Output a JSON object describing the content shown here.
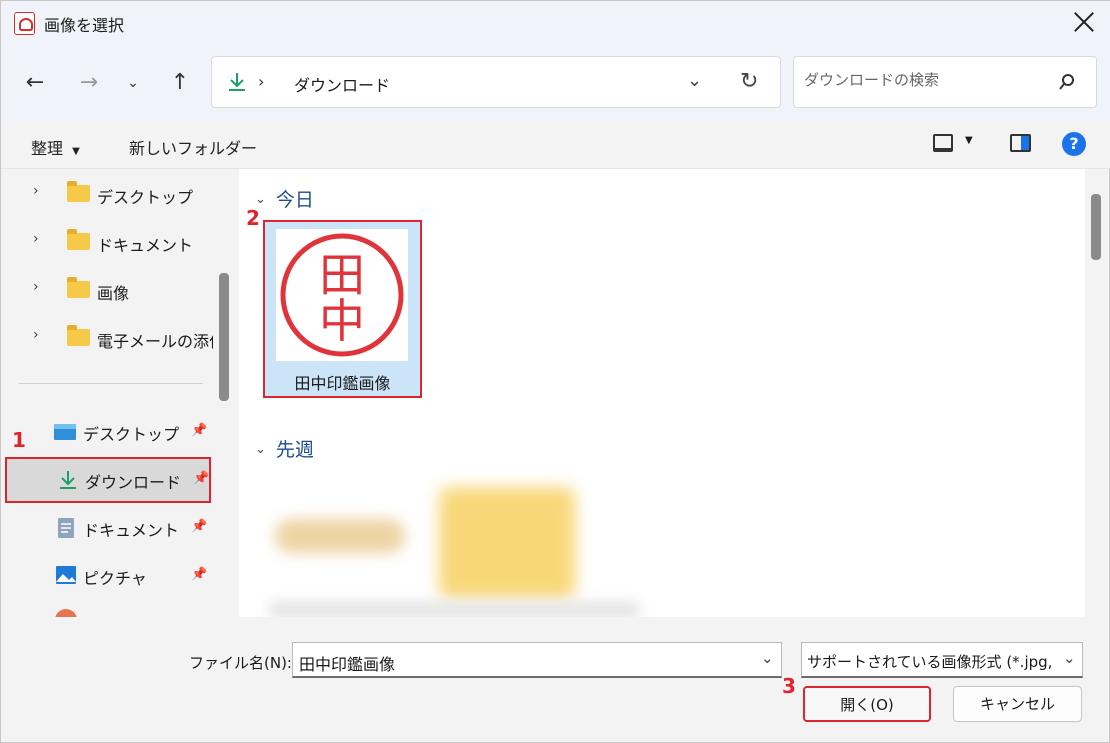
{
  "window": {
    "title": "画像を選択"
  },
  "address": {
    "current": "ダウンロード"
  },
  "search": {
    "placeholder": "ダウンロードの検索"
  },
  "toolbar": {
    "organize": "整理",
    "new_folder": "新しいフォルダー",
    "help": "?"
  },
  "sidebar": {
    "tree": [
      {
        "label": "デスクトップ",
        "icon": "folder-icon"
      },
      {
        "label": "ドキュメント",
        "icon": "folder-icon"
      },
      {
        "label": "画像",
        "icon": "folder-icon"
      },
      {
        "label": "電子メールの添付",
        "icon": "folder-icon"
      }
    ],
    "quick": [
      {
        "label": "デスクトップ",
        "icon": "desktop-icon",
        "selected": false
      },
      {
        "label": "ダウンロード",
        "icon": "download-icon",
        "selected": true
      },
      {
        "label": "ドキュメント",
        "icon": "document-icon",
        "selected": false
      },
      {
        "label": "ピクチャ",
        "icon": "picture-icon",
        "selected": false
      }
    ]
  },
  "content": {
    "groups": [
      {
        "label": "今日"
      },
      {
        "label": "先週"
      }
    ],
    "file": {
      "name": "田中印鑑画像",
      "seal_text": [
        "田",
        "中"
      ]
    }
  },
  "steps": [
    "1",
    "2",
    "3"
  ],
  "bottom": {
    "filename_label": "ファイル名(N):",
    "filename_value": "田中印鑑画像",
    "filetype": "サポートされている画像形式 (*.jpg, ",
    "open_button": "開く(O)",
    "cancel_button": "キャンセル"
  },
  "colors": {
    "highlight": "#e0242f",
    "accent": "#1a73e8",
    "seal": "#e0343a"
  }
}
